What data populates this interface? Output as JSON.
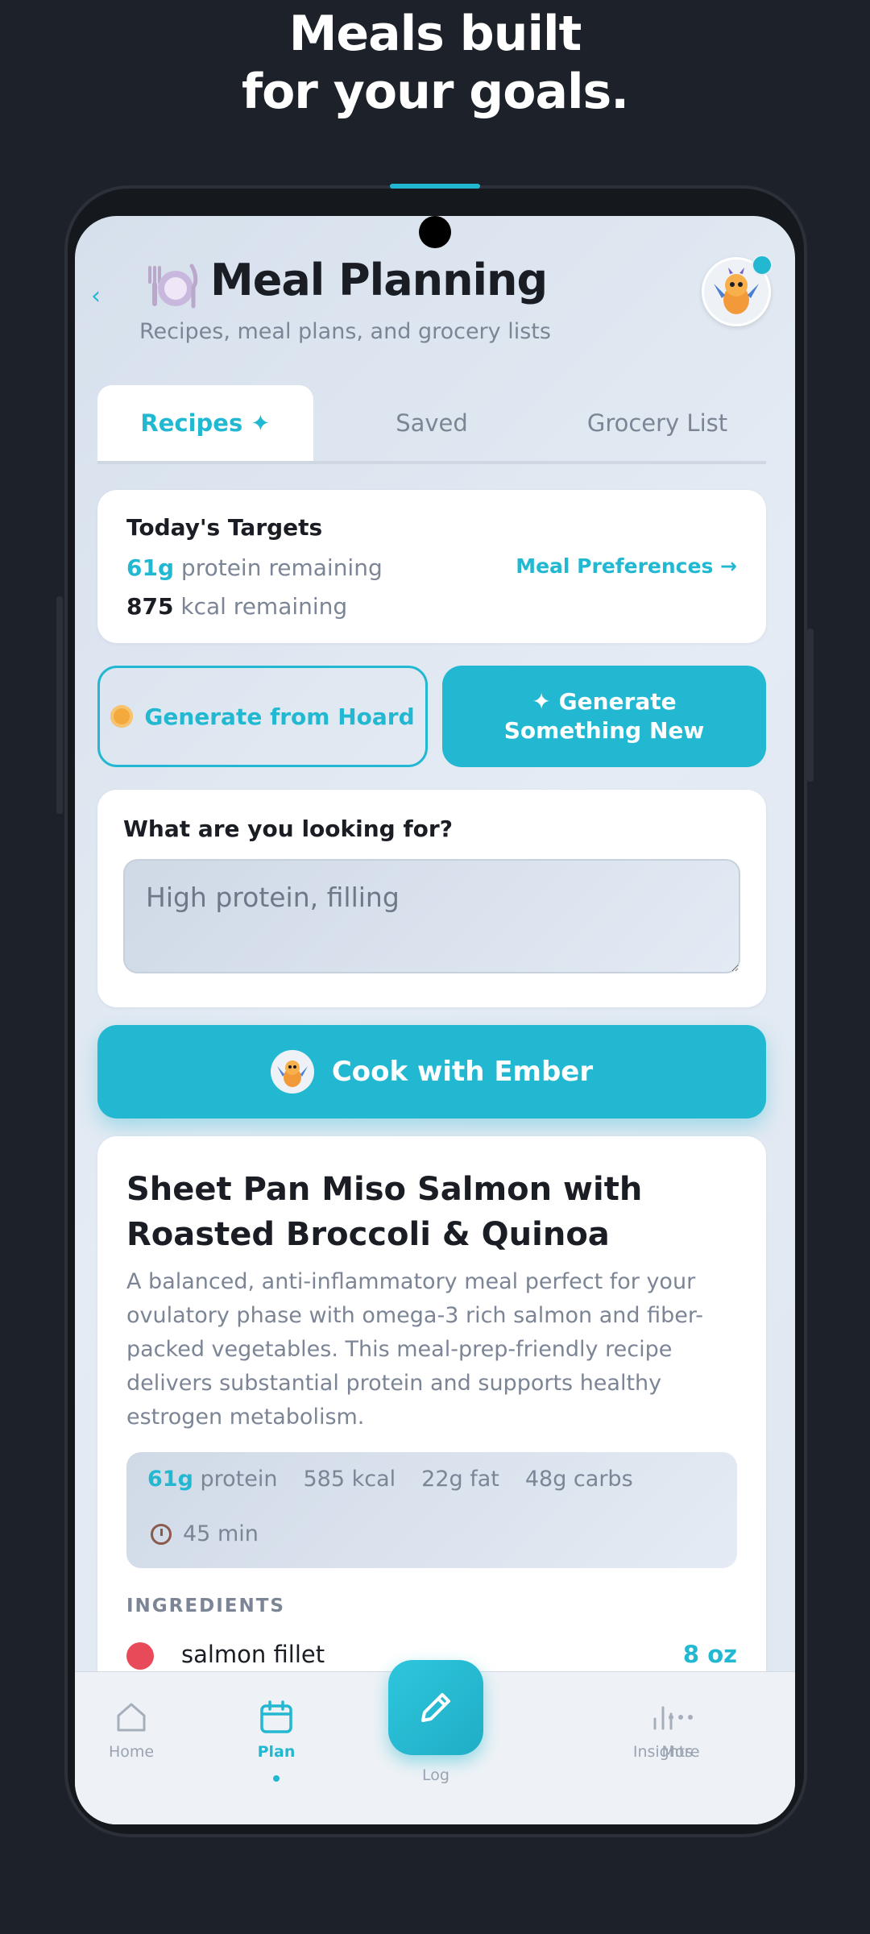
{
  "headline": {
    "line1": "Meals built",
    "line2": "for your goals."
  },
  "header": {
    "back": "‹",
    "title": "Meal Planning",
    "subtitle": "Recipes, meal plans, and grocery lists"
  },
  "tabs": [
    {
      "label": "Recipes ✦",
      "active": true
    },
    {
      "label": "Saved",
      "active": false
    },
    {
      "label": "Grocery List",
      "active": false
    }
  ],
  "targets": {
    "title": "Today's Targets",
    "protein_value": "61g",
    "protein_text": "protein remaining",
    "kcal_value": "875",
    "kcal_text": "kcal remaining",
    "preferences_link": "Meal Preferences →"
  },
  "actions": {
    "hoard_label": "Generate from Hoard",
    "new_label": "✦ Generate Something New"
  },
  "search": {
    "label": "What are you looking for?",
    "placeholder": "High protein, filling",
    "value": ""
  },
  "cook_button": {
    "label": "Cook with Ember"
  },
  "recipe": {
    "title": "Sheet Pan Miso Salmon with Roasted Broccoli & Quinoa",
    "description": "A balanced, anti-inflammatory meal perfect for your ovulatory phase with omega-3 rich salmon and fiber-packed vegetables. This meal-prep-friendly recipe delivers substantial protein and supports healthy estrogen metabolism.",
    "protein_value": "61g",
    "protein_label": "protein",
    "kcal": "585 kcal",
    "fat": "22g fat",
    "carbs": "48g carbs",
    "time": "45 min",
    "ingredients_label": "INGREDIENTS",
    "ingredients": [
      {
        "name": "salmon fillet",
        "qty": "8 oz"
      }
    ]
  },
  "nav": {
    "home": "Home",
    "plan": "Plan",
    "log": "Log",
    "insights": "Insights",
    "more": "More"
  },
  "colors": {
    "accent": "#22b8d1",
    "background": "#1d2129",
    "text": "#1a1d24",
    "muted": "#7c8595"
  }
}
